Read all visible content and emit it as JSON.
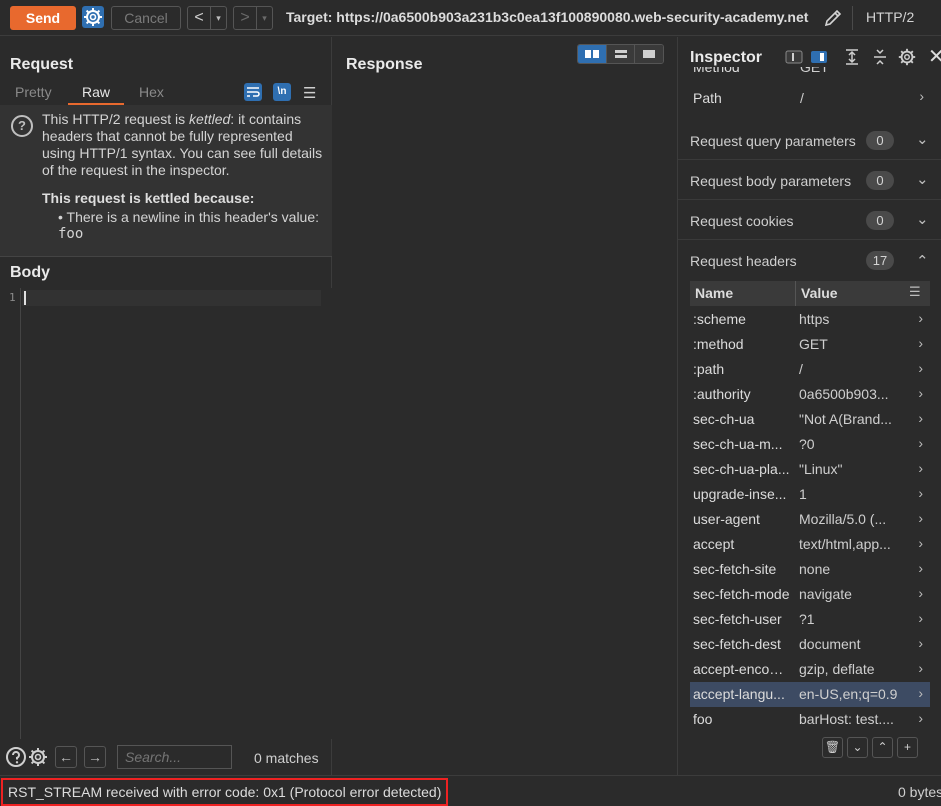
{
  "toolbar": {
    "send_label": "Send",
    "cancel_label": "Cancel",
    "back_arrow": "<",
    "forward_arrow": ">",
    "dropdown_glyph": "▾",
    "target": "Target: https://0a6500b903a231b3c0ea13f100890080.web-security-academy.net",
    "protocol": "HTTP/2"
  },
  "request": {
    "title": "Request",
    "tabs": [
      {
        "label": "Pretty",
        "active": false
      },
      {
        "label": "Raw",
        "active": true
      },
      {
        "label": "Hex",
        "active": false
      }
    ],
    "newline_toggle": "\\n",
    "notice": {
      "text_before": "This HTTP/2 request is ",
      "text_em": "kettled",
      "text_after": ": it contains headers that cannot be fully represented using HTTP/1 syntax. You can see full details of the request in the inspector.",
      "reason_heading": "This request is kettled because:",
      "reason_bullet": "• There is a newline in this header's value:",
      "reason_value": "foo"
    },
    "body_title": "Body",
    "line_number": "1",
    "search_placeholder": "Search...",
    "matches": "0 matches"
  },
  "response": {
    "title": "Response"
  },
  "inspector": {
    "title": "Inspector",
    "top_rows": [
      {
        "key": "Method",
        "value": "GET"
      },
      {
        "key": "Path",
        "value": "/"
      }
    ],
    "sections": [
      {
        "label": "Request query parameters",
        "count": "0",
        "expanded": false
      },
      {
        "label": "Request body parameters",
        "count": "0",
        "expanded": false
      },
      {
        "label": "Request cookies",
        "count": "0",
        "expanded": false
      },
      {
        "label": "Request headers",
        "count": "17",
        "expanded": true
      }
    ],
    "header_table": {
      "col_name": "Name",
      "col_value": "Value",
      "rows": [
        {
          "name": ":scheme",
          "value": "https"
        },
        {
          "name": ":method",
          "value": "GET"
        },
        {
          "name": ":path",
          "value": "/"
        },
        {
          "name": ":authority",
          "value": "0a6500b903..."
        },
        {
          "name": "sec-ch-ua",
          "value": "\"Not A(Brand..."
        },
        {
          "name": "sec-ch-ua-m...",
          "value": "?0"
        },
        {
          "name": "sec-ch-ua-pla...",
          "value": "\"Linux\""
        },
        {
          "name": "upgrade-inse...",
          "value": "1"
        },
        {
          "name": "user-agent",
          "value": "Mozilla/5.0 (..."
        },
        {
          "name": "accept",
          "value": "text/html,app..."
        },
        {
          "name": "sec-fetch-site",
          "value": "none"
        },
        {
          "name": "sec-fetch-mode",
          "value": "navigate"
        },
        {
          "name": "sec-fetch-user",
          "value": "?1"
        },
        {
          "name": "sec-fetch-dest",
          "value": "document"
        },
        {
          "name": "accept-encodi...",
          "value": "gzip, deflate"
        },
        {
          "name": "accept-langu...",
          "value": "en-US,en;q=0.9",
          "selected": true
        },
        {
          "name": "foo",
          "value": "barHost: test...."
        }
      ]
    }
  },
  "status": {
    "message": "RST_STREAM received with error code: 0x1 (Protocol error detected)",
    "bytes": "0 bytes"
  },
  "colors": {
    "accent_orange": "#e8692e",
    "accent_blue": "#2f6fb1",
    "error_red": "#ee2222",
    "background": "#2b2b2b"
  }
}
